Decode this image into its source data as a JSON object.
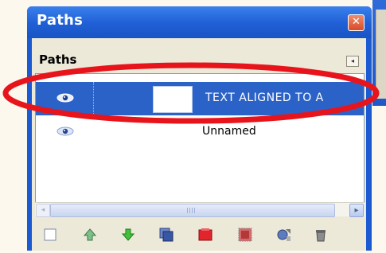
{
  "window": {
    "title": "Paths",
    "close_label": "✕"
  },
  "tab": {
    "label": "Paths",
    "menu_glyph": "◂"
  },
  "paths": [
    {
      "label": "TEXT ALIGNED TO A",
      "visible": true,
      "selected": true,
      "icon": "eye-icon"
    },
    {
      "label": "Unnamed",
      "visible": true,
      "selected": false,
      "icon": "eye-icon"
    }
  ],
  "scrollbar": {
    "left_glyph": "◂",
    "right_glyph": "▸"
  },
  "toolbar": [
    {
      "name": "new-path-button",
      "icon": "new-path-icon"
    },
    {
      "name": "raise-path-button",
      "icon": "raise-arrow-icon"
    },
    {
      "name": "lower-path-button",
      "icon": "lower-arrow-icon"
    },
    {
      "name": "duplicate-path-button",
      "icon": "duplicate-path-icon"
    },
    {
      "name": "path-to-selection-button",
      "icon": "path-to-selection-icon"
    },
    {
      "name": "selection-to-path-button",
      "icon": "selection-to-path-icon"
    },
    {
      "name": "paint-along-path-button",
      "icon": "paint-along-path-icon"
    },
    {
      "name": "delete-path-button",
      "icon": "trash-icon"
    }
  ],
  "colors": {
    "titlebar": "#1f5fd6",
    "selection": "#2b62c8",
    "annotation": "#e8141c",
    "panel": "#ece9d8"
  }
}
